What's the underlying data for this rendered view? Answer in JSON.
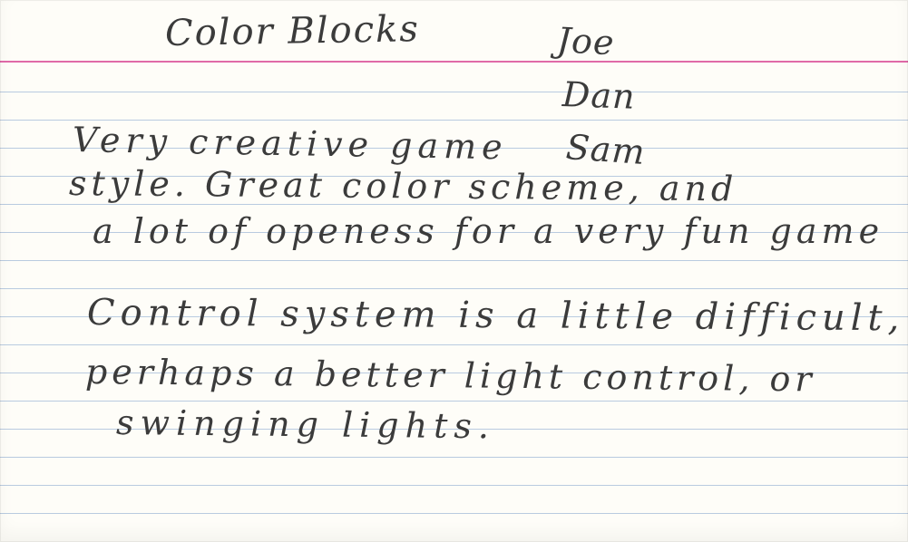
{
  "card": {
    "title": "Color Blocks",
    "names": [
      "Joe",
      "Dan",
      "Sam"
    ],
    "lines": [
      "Very creative game",
      "style. Great color scheme, and",
      "a lot of openess for a very fun game",
      "Control system is a little difficult,",
      "perhaps a better light control, or",
      "swinging lights."
    ]
  },
  "colors": {
    "paper": "#fefdf8",
    "rule_blue": "#b9cbe0",
    "margin_red": "#e06aa8",
    "ink": "#3b3b3b"
  }
}
